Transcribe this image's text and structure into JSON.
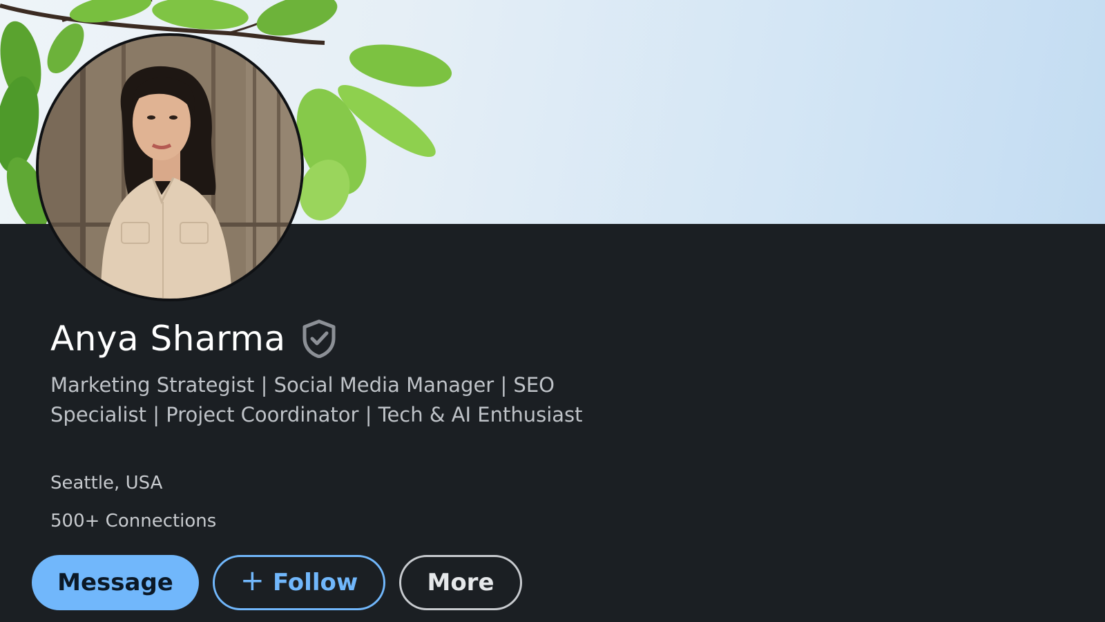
{
  "profile": {
    "name": "Anya Sharma",
    "headline": "Marketing Strategist | Social Media Manager | SEO Specialist | Project Coordinator | Tech & AI Enthusiast",
    "location": "Seattle, USA",
    "connections": "500+ Connections",
    "verified_icon": "shield-check-icon"
  },
  "actions": {
    "message_label": "Message",
    "follow_label": "Follow",
    "follow_icon": "plus-icon",
    "more_label": "More"
  },
  "colors": {
    "background": "#1b1f23",
    "primary_button": "#71b7fb",
    "text_primary": "#ffffff",
    "text_secondary": "#bfc3c8"
  }
}
